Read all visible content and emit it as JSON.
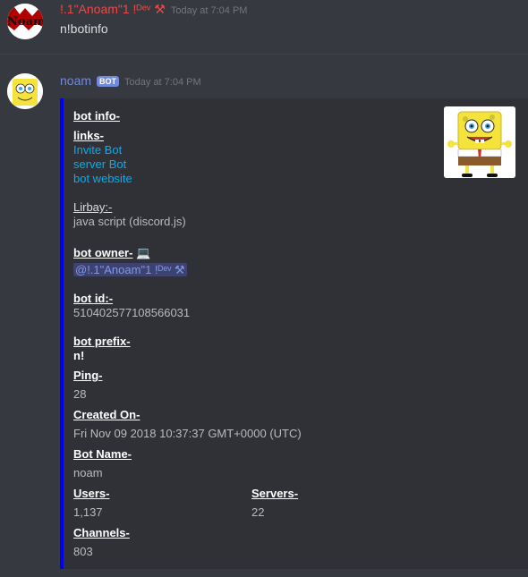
{
  "message1": {
    "author": "!.1\"Anoam\"1 !ᴰᵉᵛ ⚒",
    "timestamp": "Today at 7:04 PM",
    "content": "n!botinfo",
    "avatar_text": "Noam"
  },
  "message2": {
    "author": "noam",
    "bot_tag": "BOT",
    "timestamp": "Today at 7:04 PM",
    "embed": {
      "title": "bot info-",
      "links_label": "links-",
      "links": [
        "Invite Bot",
        "server Bot",
        "bot website"
      ],
      "library_label": "Lirbay:-",
      "library_value": "java script (discord.js)",
      "owner_label": "bot owner-",
      "owner_emoji": "💻",
      "owner_mention": "@!.1\"Anoam\"1 !ᴰᵉᵛ ⚒",
      "id_label": "bot id:-",
      "id_value": "510402577108566031",
      "prefix_label": "bot prefix-",
      "prefix_value": "n!",
      "fields": {
        "ping_name": "Ping-",
        "ping_value": "28",
        "created_name": "Created On-",
        "created_value": "Fri Nov 09 2018 10:37:37 GMT+0000 (UTC)",
        "botname_name": "Bot Name-",
        "botname_value": "noam",
        "users_name": "Users-",
        "users_value": "1,137",
        "servers_name": "Servers-",
        "servers_value": "22",
        "channels_name": "Channels-",
        "channels_value": "803"
      }
    }
  },
  "colors": {
    "background": "#36393f",
    "embed_bg": "#2f3136",
    "embed_border": "#0000ee",
    "author1": "#f04747",
    "author2": "#7289da",
    "link": "#00b0f4"
  }
}
